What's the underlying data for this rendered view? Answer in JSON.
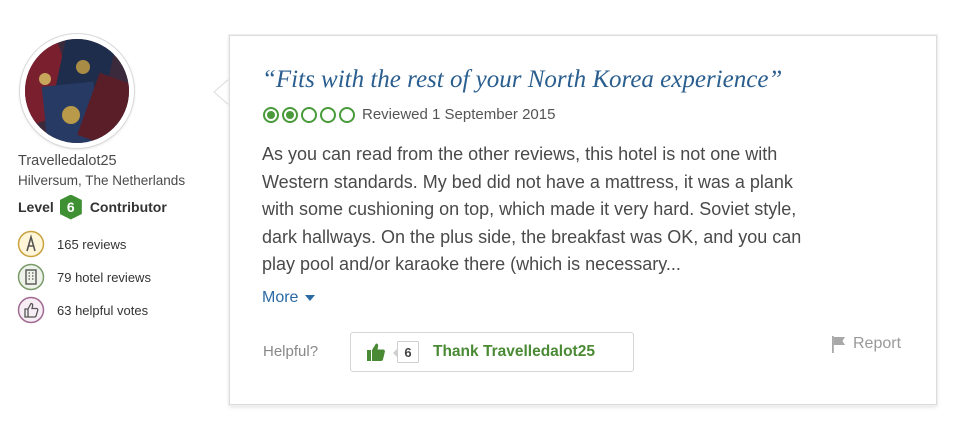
{
  "reviewer": {
    "username": "Travelledalot25",
    "location": "Hilversum, The Netherlands",
    "level_label": "Level",
    "level": "6",
    "level_suffix": "Contributor",
    "stats": [
      {
        "icon": "pen-badge-icon",
        "label": "165 reviews"
      },
      {
        "icon": "hotel-building-icon",
        "label": "79 hotel reviews"
      },
      {
        "icon": "thumbs-up-outline-icon",
        "label": "63 helpful votes"
      }
    ]
  },
  "review": {
    "title": "“Fits with the rest of your North Korea experience”",
    "rating": 2,
    "rating_max": 5,
    "date": "Reviewed 1 September 2015",
    "body_lines": [
      "As you can read from the other reviews, this hotel is not one with",
      "Western standards. My bed did not have a mattress, it was a plank",
      "with some cushioning on top, which made it very hard. Soviet style,",
      "dark hallways. On the plus side, the breakfast was OK, and you can",
      "play pool and/or karaoke there (which is necessary..."
    ],
    "more_label": "More"
  },
  "actions": {
    "helpful_label": "Helpful?",
    "thank_count": "6",
    "thank_label": "Thank Travelledalot25",
    "report_label": "Report"
  },
  "colors": {
    "title_blue": "#2a5e8e",
    "link_blue": "#2a6aa3",
    "rating_green": "#4a9a3b",
    "thank_green": "#4a8a34",
    "level_badge_green": "#3f8f33"
  }
}
